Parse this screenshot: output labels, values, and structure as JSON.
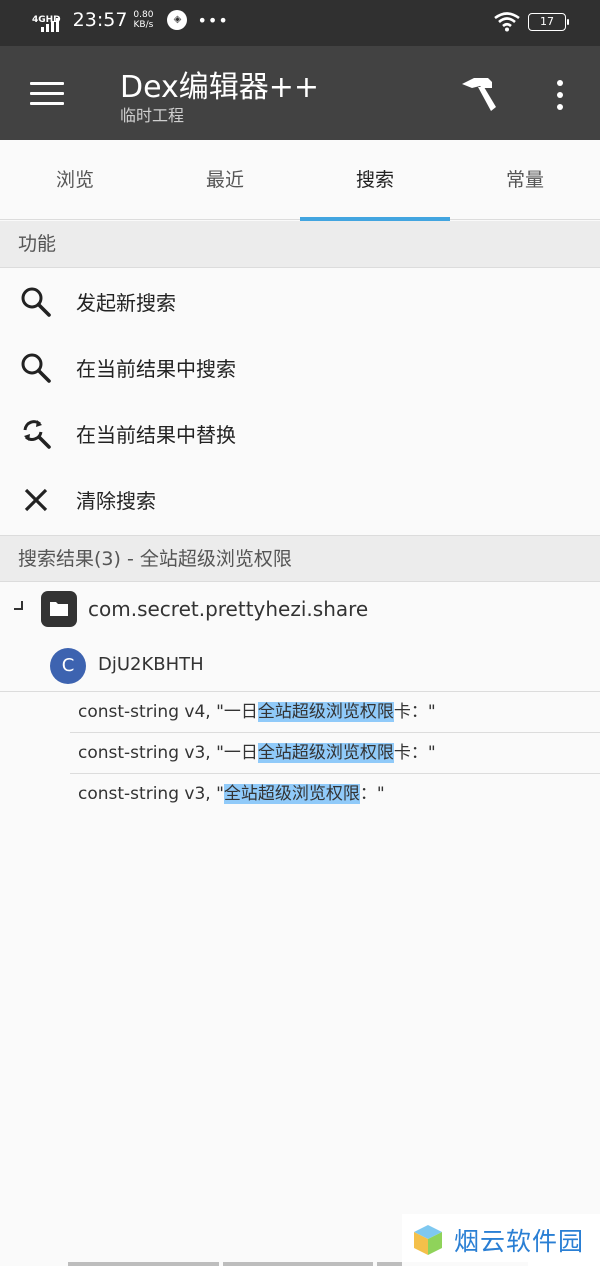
{
  "status_bar": {
    "network": "4GHD",
    "time": "23:57",
    "speed_value": "0.80",
    "speed_unit": "KB/s",
    "battery": "17"
  },
  "app_bar": {
    "title": "Dex编辑器++",
    "subtitle": "临时工程"
  },
  "tabs": [
    {
      "label": "浏览",
      "active": false
    },
    {
      "label": "最近",
      "active": false
    },
    {
      "label": "搜索",
      "active": true
    },
    {
      "label": "常量",
      "active": false
    }
  ],
  "functions": {
    "header": "功能",
    "items": [
      {
        "label": "发起新搜索",
        "icon": "search-icon"
      },
      {
        "label": "在当前结果中搜索",
        "icon": "search-icon"
      },
      {
        "label": "在当前结果中替换",
        "icon": "find-replace-icon"
      },
      {
        "label": "清除搜索",
        "icon": "close-icon"
      }
    ]
  },
  "results": {
    "header": "搜索结果(3) - 全站超级浏览权限",
    "root_package": "com.secret.prettyhezi.share",
    "class_icon_letter": "C",
    "class_name": "DjU2KBHTH",
    "rows": [
      {
        "pre": "const-string v4, \"一日",
        "match": "全站超级浏览权限",
        "post": "卡：\""
      },
      {
        "pre": "const-string v3, \"一日",
        "match": "全站超级浏览权限",
        "post": "卡：\""
      },
      {
        "pre": "const-string v3, \"",
        "match": "全站超级浏览权限",
        "post": "：\""
      }
    ]
  },
  "watermark": {
    "text": "烟云软件园"
  },
  "colors": {
    "status_bar": "#303030",
    "app_bar": "#424242",
    "tab_indicator": "#42a5e0",
    "highlight": "#90caf9",
    "class_avatar": "#3d63b0"
  }
}
